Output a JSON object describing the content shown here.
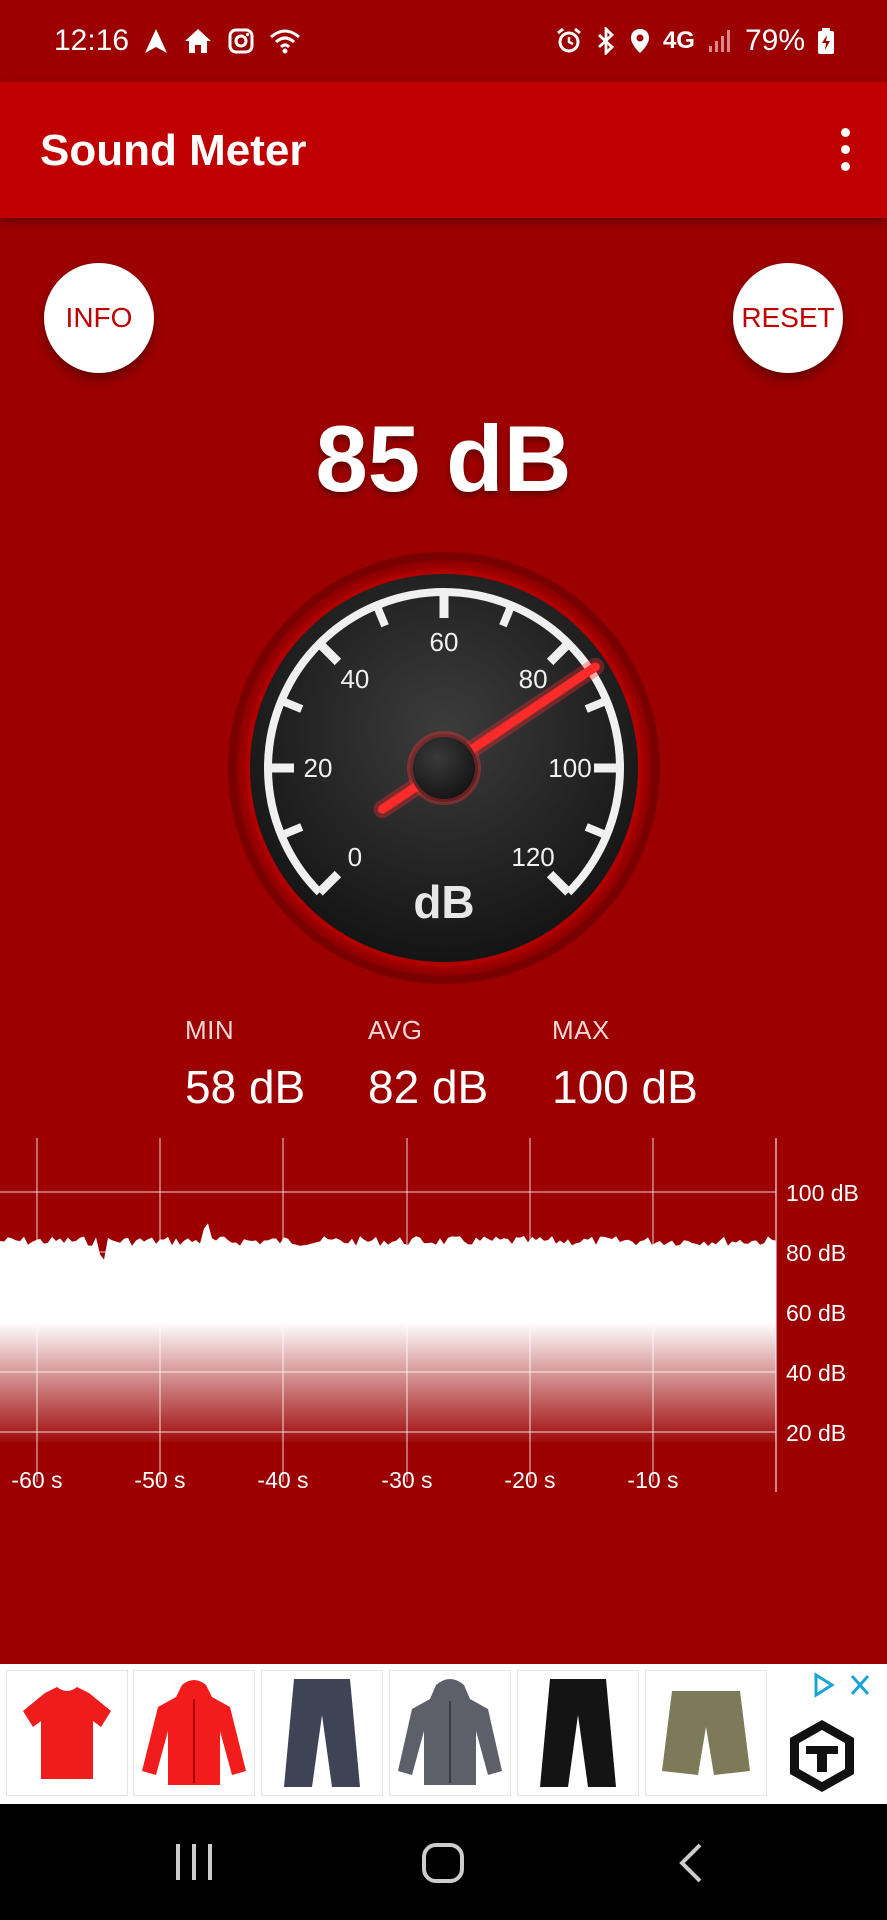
{
  "status_bar": {
    "time": "12:16",
    "network": "4G",
    "battery": "79%"
  },
  "app_bar": {
    "title": "Sound Meter"
  },
  "buttons": {
    "info_label": "INFO",
    "reset_label": "RESET"
  },
  "reading": {
    "current": "85 dB",
    "needle_value": 85
  },
  "gauge": {
    "unit_label": "dB",
    "scale_min": 0,
    "scale_max": 120,
    "tick_labels": [
      "0",
      "20",
      "40",
      "60",
      "80",
      "100",
      "120"
    ]
  },
  "stats": {
    "min_label": "MIN",
    "min_value": "58 dB",
    "avg_label": "AVG",
    "avg_value": "82 dB",
    "max_label": "MAX",
    "max_value": "100 dB"
  },
  "history_graph": {
    "y_labels": [
      "100 dB",
      "80 dB",
      "60 dB",
      "40 dB",
      "20 dB"
    ],
    "x_labels": [
      "-60 s",
      "-50 s",
      "-40 s",
      "-30 s",
      "-20 s",
      "-10 s"
    ],
    "level_db": 83
  },
  "ad": {
    "products": [
      "red-tshirt",
      "red-hooded-jacket",
      "gray-pants",
      "gray-hoodie",
      "black-pants",
      "olive-shorts"
    ],
    "brand_logo": "brand-logo-icon"
  },
  "colors": {
    "background": "#9c0000",
    "app_bar": "#c00000",
    "accent": "#ff2020",
    "needle": "#ff2b2b"
  }
}
